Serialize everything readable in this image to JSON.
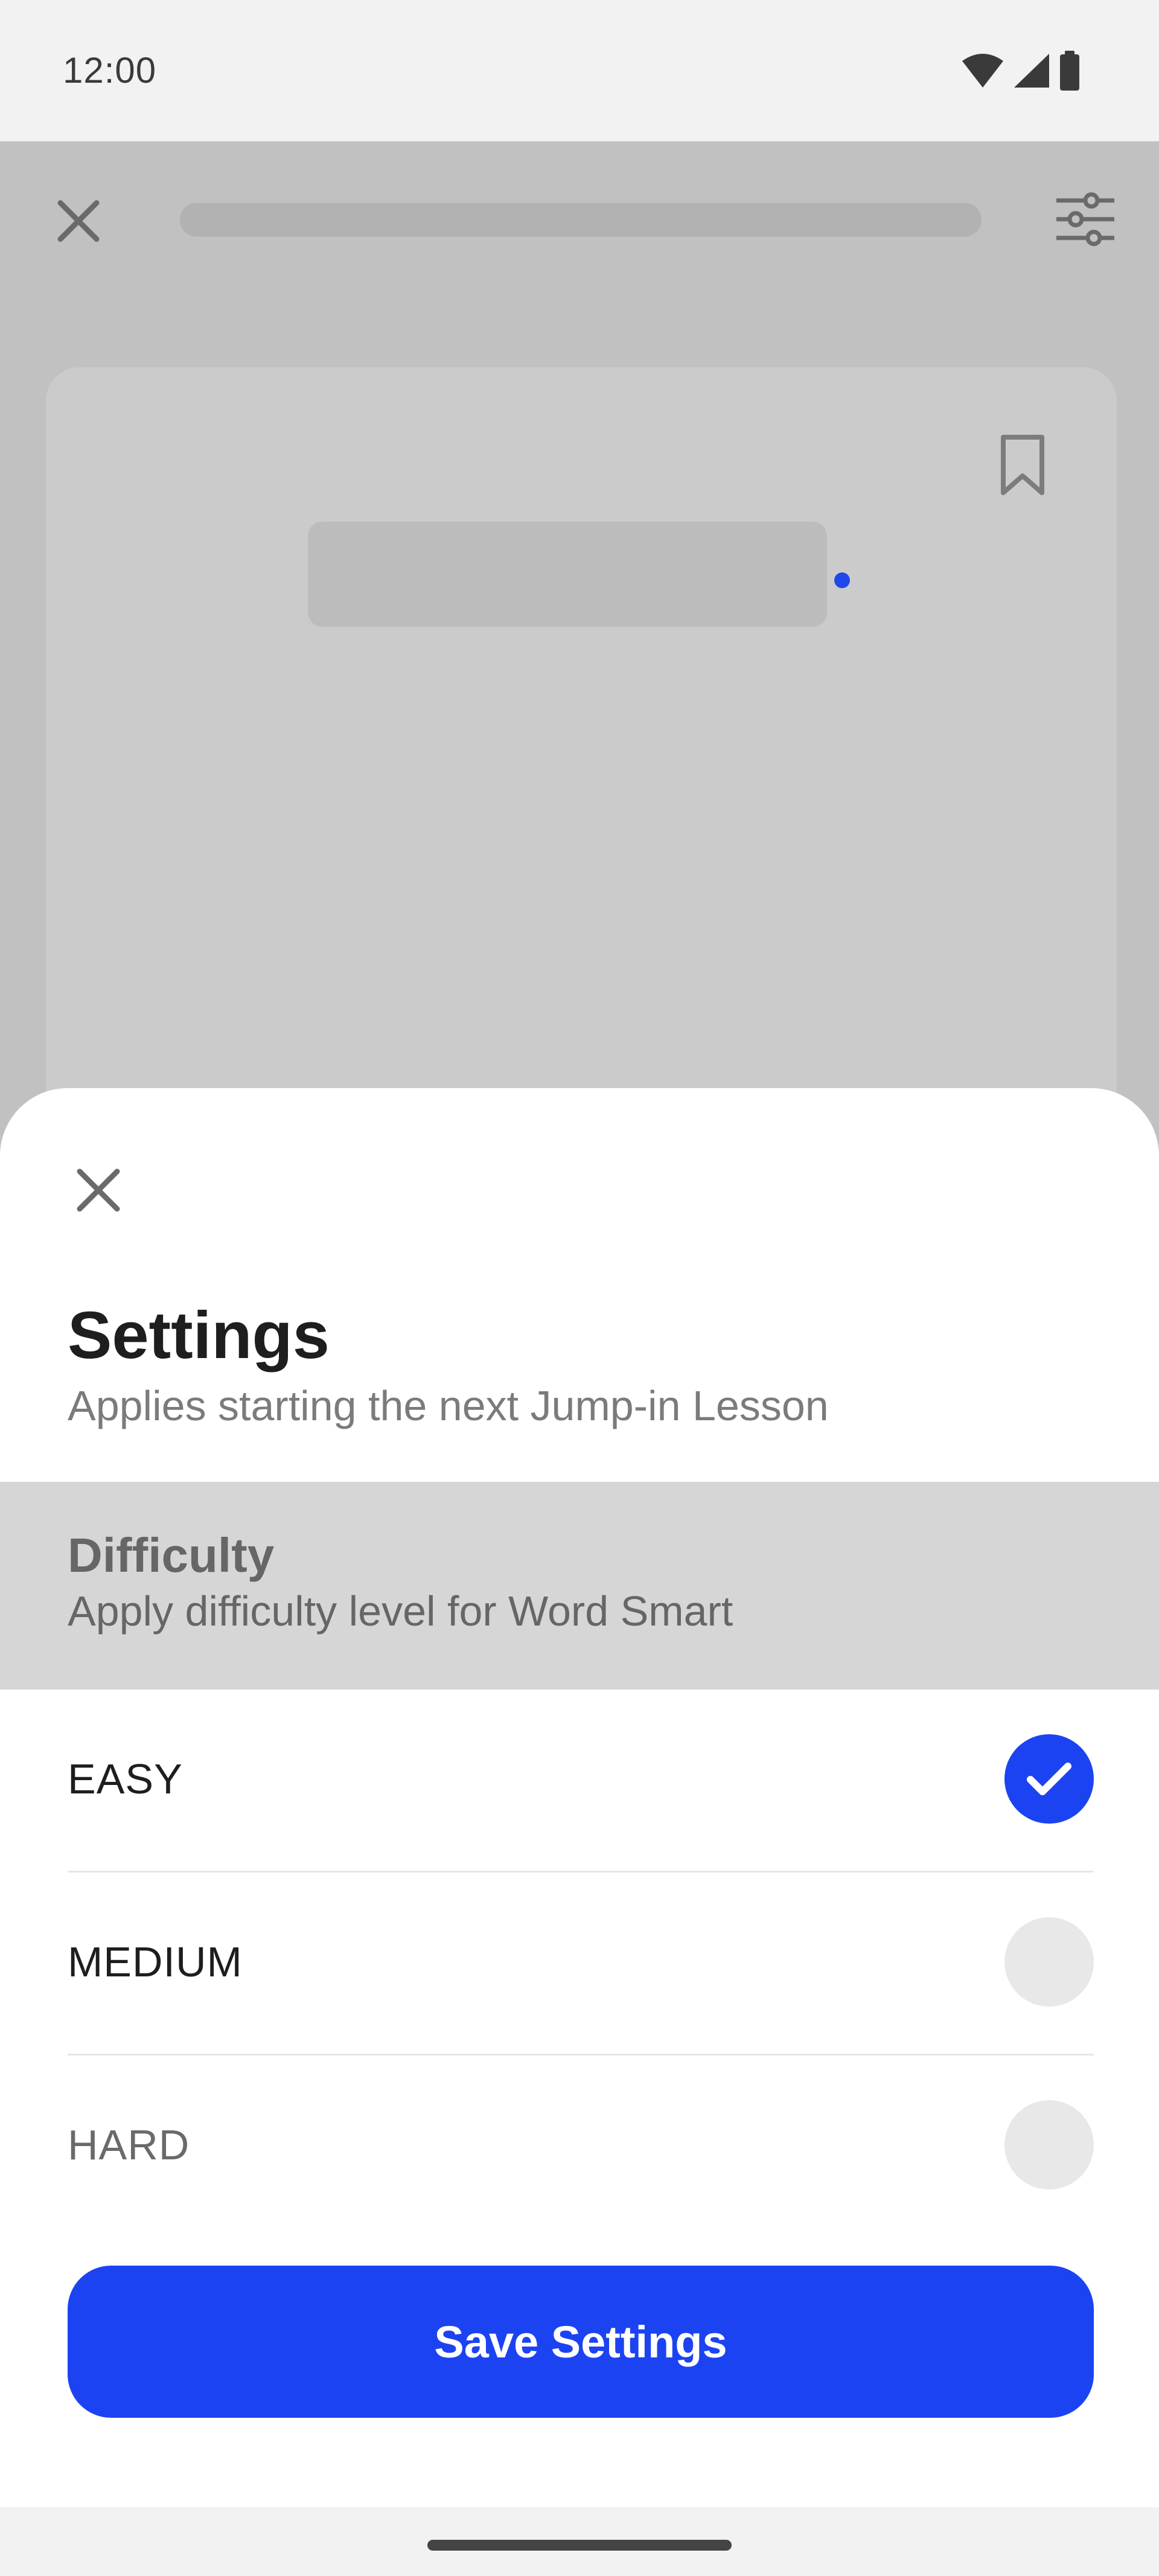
{
  "status_bar": {
    "time": "12:00",
    "icons": [
      "wifi-icon",
      "signal-icon",
      "battery-icon"
    ]
  },
  "background_app": {
    "icons": [
      "close-icon",
      "filter-icon",
      "bookmark-icon"
    ],
    "accent": "#1f47ea"
  },
  "sheet": {
    "close_icon": "close-icon",
    "title": "Settings",
    "subtitle": "Applies starting the next Jump-in Lesson",
    "section": {
      "title": "Difficulty",
      "description": "Apply difficulty level for Word Smart"
    },
    "options": [
      {
        "label": "EASY",
        "selected": true
      },
      {
        "label": "MEDIUM",
        "selected": false
      },
      {
        "label": "HARD",
        "selected": false
      }
    ],
    "save_label": "Save Settings"
  },
  "colors": {
    "primary": "#1c43f2",
    "scrim": "#c1c1c1",
    "section_bg": "#d6d6d6"
  }
}
